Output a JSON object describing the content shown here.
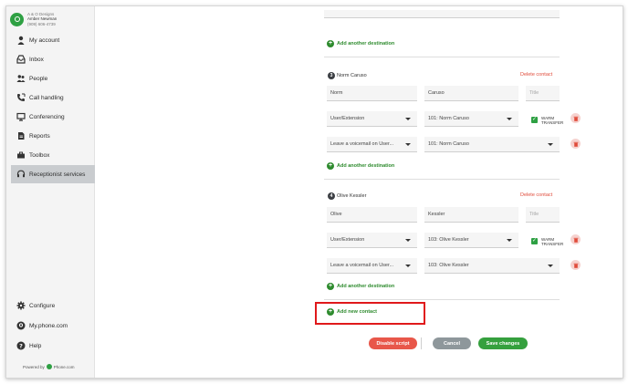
{
  "account": {
    "company": "A & O Designs",
    "user": "Amber Newman",
    "phone": "(909) 606-4739"
  },
  "sidebar": {
    "items": [
      {
        "label": "My account",
        "icon": "person-icon"
      },
      {
        "label": "Inbox",
        "icon": "inbox-icon"
      },
      {
        "label": "People",
        "icon": "people-icon"
      },
      {
        "label": "Call handling",
        "icon": "call-handling-icon"
      },
      {
        "label": "Conferencing",
        "icon": "monitor-icon"
      },
      {
        "label": "Reports",
        "icon": "reports-icon"
      },
      {
        "label": "Toolbox",
        "icon": "toolbox-icon"
      },
      {
        "label": "Receptionist services",
        "icon": "headset-icon"
      }
    ],
    "bottom_items": [
      {
        "label": "Configure",
        "icon": "gear-icon"
      },
      {
        "label": "My.phone.com",
        "icon": "location-pin-icon"
      },
      {
        "label": "Help",
        "icon": "help-icon"
      }
    ],
    "powered_by": "Powered by",
    "powered_brand": "Phone.com"
  },
  "top_add_destination": "Add another destination",
  "contacts": [
    {
      "number": "3",
      "name": "Norm Caruso",
      "delete_label": "Delete contact",
      "first_name": "Norm",
      "last_name": "Caruso",
      "title_placeholder": "Title",
      "destinations": [
        {
          "type": "User/Extension",
          "target": "101: Norm Caruso",
          "warm_transfer": true,
          "warm_label_1": "WARM",
          "warm_label_2": "TRANSFER"
        },
        {
          "type": "Leave a voicemail on User...",
          "target": "101: Norm Caruso"
        }
      ],
      "add_destination": "Add another destination"
    },
    {
      "number": "4",
      "name": "Olive Kessler",
      "delete_label": "Delete contact",
      "first_name": "Olive",
      "last_name": "Kessler",
      "title_placeholder": "Title",
      "destinations": [
        {
          "type": "User/Extension",
          "target": "103: Olive Kessler",
          "warm_transfer": true,
          "warm_label_1": "WARM",
          "warm_label_2": "TRANSFER"
        },
        {
          "type": "Leave a voicemail on User...",
          "target": "103: Olive Kessler"
        }
      ],
      "add_destination": "Add another destination"
    }
  ],
  "add_new_contact": "Add new contact",
  "buttons": {
    "disable": "Disable script",
    "cancel": "Cancel",
    "save": "Save changes"
  },
  "colors": {
    "accent_green": "#2ea043",
    "delete_red": "#e04b3a",
    "highlight_red": "#e0191b"
  }
}
